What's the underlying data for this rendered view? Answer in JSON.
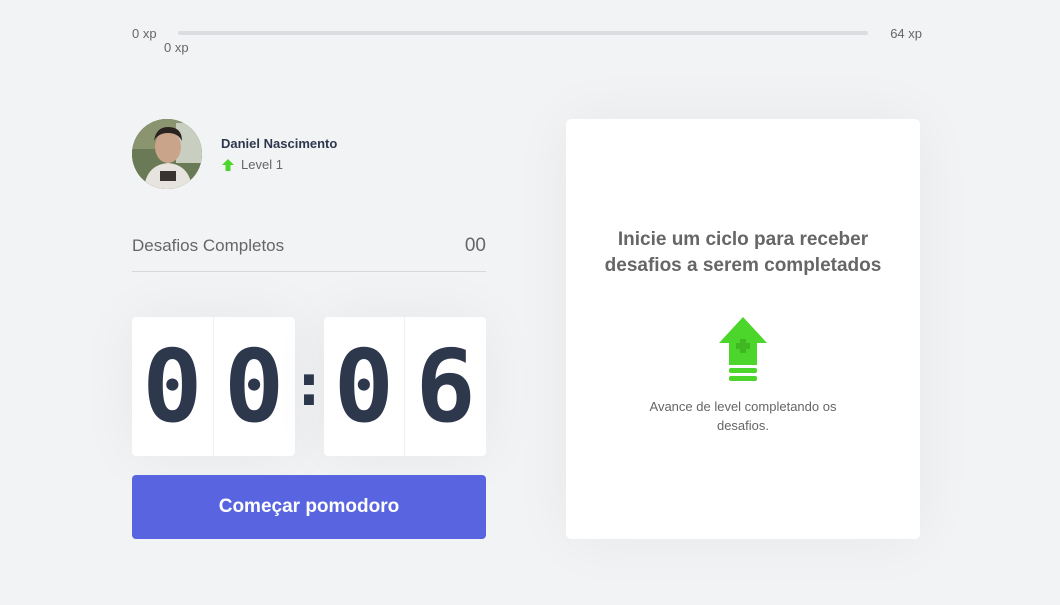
{
  "experience_bar": {
    "min_label": "0 xp",
    "max_label": "64 xp",
    "current_label": "0 xp",
    "progress_fraction": 0
  },
  "profile": {
    "name": "Daniel Nascimento",
    "level": "Level 1",
    "level_icon": "level-up-arrow-icon"
  },
  "completed_challenges": {
    "label": "Desafios Completos",
    "count": "00"
  },
  "countdown": {
    "minute_left": "0",
    "minute_right": "0",
    "separator": ":",
    "second_left": "0",
    "second_right": "6"
  },
  "start_button": {
    "label": "Começar pomodoro"
  },
  "challenge_box": {
    "title": "Inicie um ciclo para receber desafios a serem completados",
    "icon": "level-up-icon",
    "description": "Avance de level completando os desafios."
  },
  "colors": {
    "background": "#f2f3f5",
    "accent_blue": "#5965e0",
    "accent_green": "#4cd62b",
    "title_dark": "#2e384d",
    "text": "#666666"
  }
}
